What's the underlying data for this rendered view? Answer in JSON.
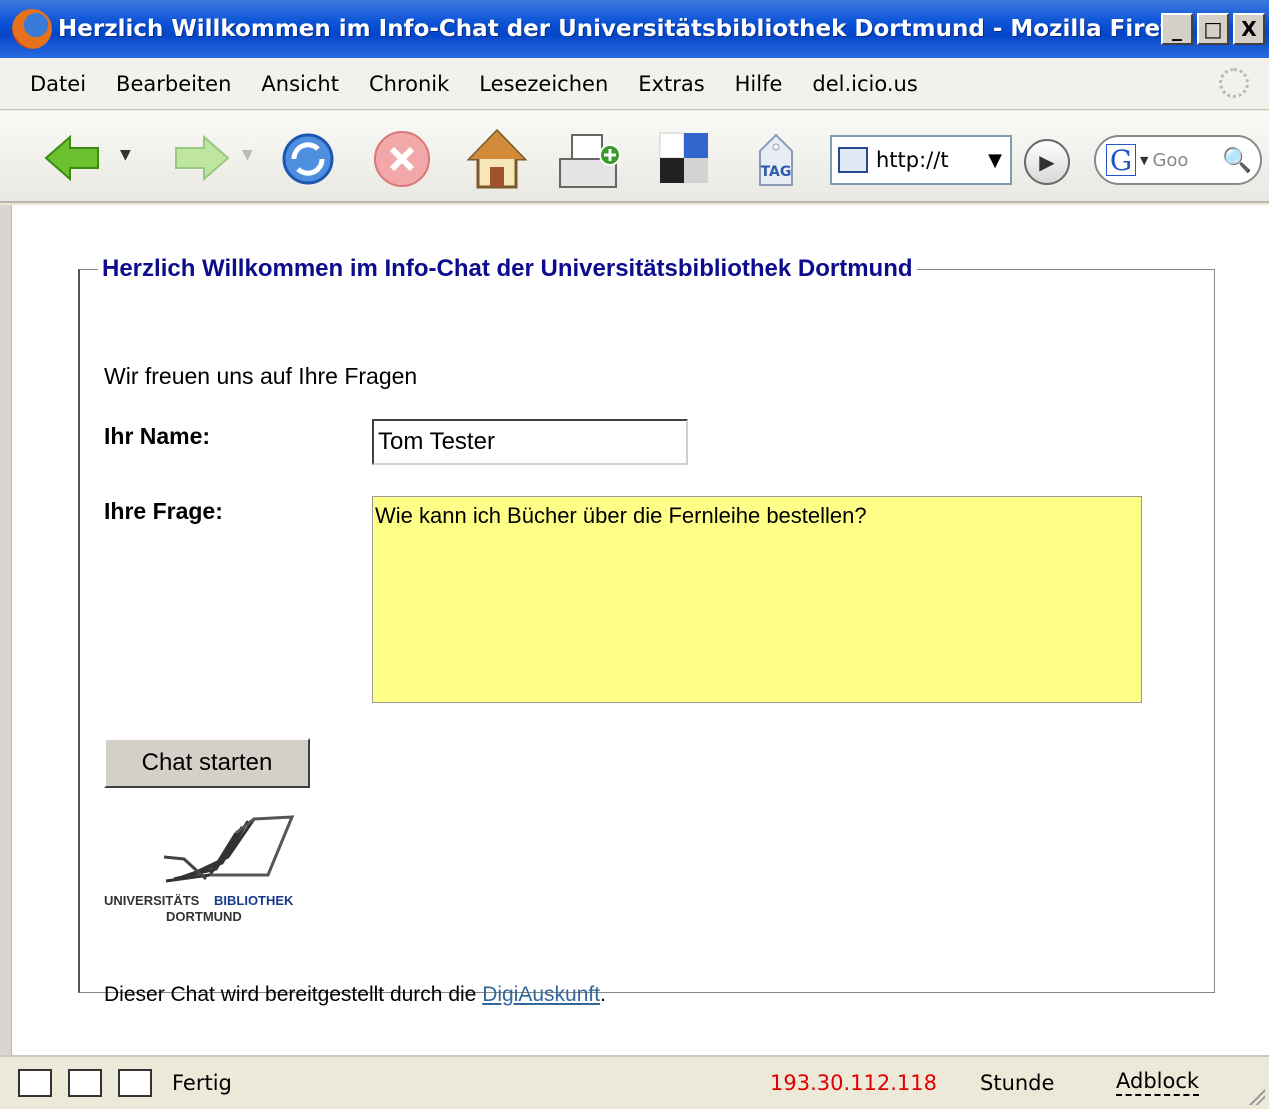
{
  "window": {
    "title": "Herzlich Willkommen im Info-Chat der Universitätsbibliothek Dortmund - Mozilla Firefox",
    "buttons": [
      "_",
      "□",
      "X"
    ]
  },
  "menu": [
    "Datei",
    "Bearbeiten",
    "Ansicht",
    "Chronik",
    "Lesezeichen",
    "Extras",
    "Hilfe",
    "del.icio.us"
  ],
  "toolbar": {
    "url": "http://t",
    "search_placeholder": "Goo",
    "tag_label": "TAG"
  },
  "page": {
    "legend": "Herzlich Willkommen im Info-Chat der Universitätsbibliothek Dortmund",
    "intro": "Wir freuen uns auf Ihre Fragen",
    "name_label": "Ihr Name:",
    "name_value": "Tom Tester",
    "question_label": "Ihre Frage:",
    "question_value": "Wie kann ich Bücher über die Fernleihe bestellen?",
    "submit_label": "Chat starten",
    "logo_text_1": "UNIVERSITÄTS",
    "logo_text_2": "BIBLIOTHEK",
    "logo_text_3": "DORTMUND",
    "footer_prefix": "Dieser Chat wird bereitgestellt durch die ",
    "footer_link": "DigiAuskunft",
    "footer_suffix": "."
  },
  "status": {
    "text": "Fertig",
    "ip": "193.30.112.118",
    "stunde": "Stunde",
    "adblock": "Adblock"
  },
  "colors": {
    "legend": "#0c0c8c",
    "question_bg": "#ffff88",
    "link": "#336699",
    "ip": "#e00000"
  }
}
